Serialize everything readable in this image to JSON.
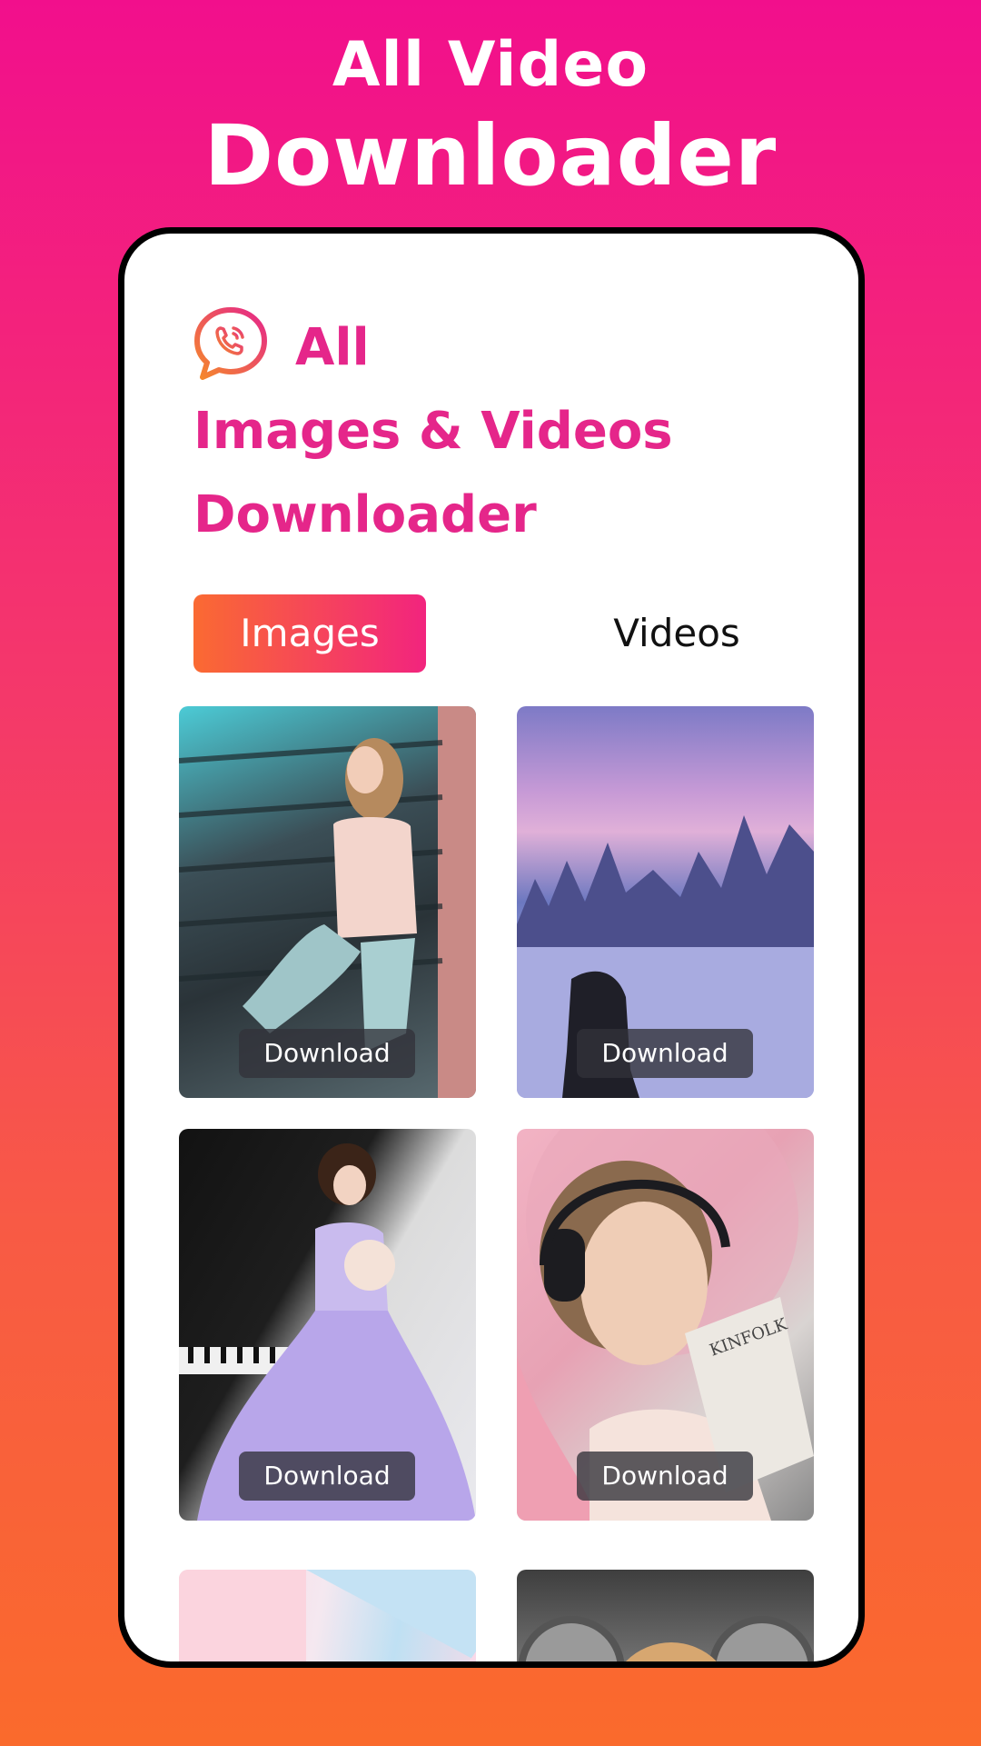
{
  "promo": {
    "line1": "All Video",
    "line2": "Downloader"
  },
  "app": {
    "title_line1": "All",
    "title_line2": "Images & Videos",
    "title_line3": "Downloader",
    "accent_color": "#E5268A"
  },
  "tabs": [
    {
      "label": "Images",
      "active": true
    },
    {
      "label": "Videos",
      "active": false
    }
  ],
  "gallery": {
    "items": [
      {
        "subject": "woman on stairs",
        "button": "Download"
      },
      {
        "subject": "snowy forest at sunset",
        "button": "Download"
      },
      {
        "subject": "woman in lavender dress by piano",
        "button": "Download"
      },
      {
        "subject": "woman with headphones and book",
        "button": "Download"
      },
      {
        "subject": "pastel geometric",
        "button": ""
      },
      {
        "subject": "woman portrait",
        "button": ""
      }
    ]
  }
}
